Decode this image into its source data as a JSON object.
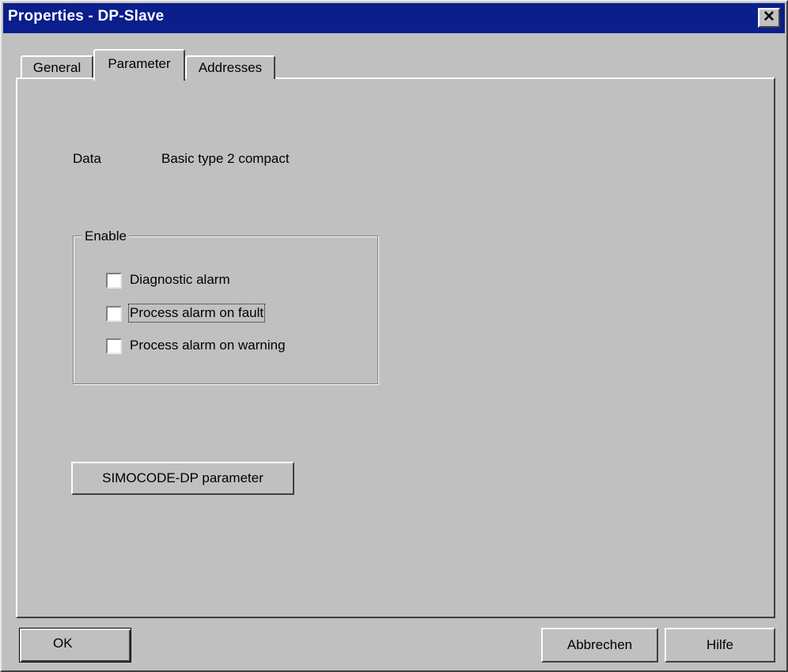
{
  "window": {
    "title": "Properties - DP-Slave",
    "close_glyph": "✕"
  },
  "tabs": [
    {
      "label": "General",
      "active": false
    },
    {
      "label": "Parameter",
      "active": true
    },
    {
      "label": "Addresses",
      "active": false
    }
  ],
  "parameter": {
    "data_label": "Data",
    "data_value": "Basic type 2 compact",
    "enable_group": {
      "title": "Enable",
      "options": [
        {
          "label": "Diagnostic alarm",
          "checked": false
        },
        {
          "label": "Process alarm on fault",
          "checked": false,
          "focused": true
        },
        {
          "label": "Process alarm on warning",
          "checked": false
        }
      ]
    },
    "simocode_button": "SIMOCODE-DP parameter"
  },
  "footer": {
    "ok": "OK",
    "cancel": "Abbrechen",
    "help": "Hilfe"
  },
  "colors": {
    "titlebar": "#0a1e8c",
    "dialog_face": "#c0c0c0"
  }
}
